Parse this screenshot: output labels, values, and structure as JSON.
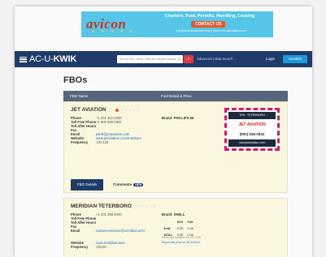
{
  "banner": {
    "logo": "avicon",
    "tagline": "Charters, Fuel, Permits, Handling, Leasing",
    "cta": "CONTACT US",
    "urls": "info@aviconaviation.com  |  www.aviconaviation.com",
    "stars": "★ ★ ★ ★ ★",
    "color_bg": "#55c6e8"
  },
  "nav": {
    "brand_prefix": "AC-U-",
    "brand_bold": "KWIK",
    "search_placeholder": "Find ICAO, IATA, FAA ID, Airport Name, or City",
    "links": "Advanced  |  Map Search",
    "login": "Login",
    "cta": "Vendors",
    "color_bg": "#1f3b6a"
  },
  "page": {
    "title": "FBOs",
    "columns": [
      "FBO Name",
      "Fuel Brand & Price"
    ]
  },
  "fbos": [
    {
      "name": "JET AVIATION",
      "rating": "☆☆☆☆☆",
      "fields": [
        {
          "label": "Phone",
          "value": "+1 201 462 4000"
        },
        {
          "label": "Toll Free Phone",
          "value": "+1 800 538 0832"
        },
        {
          "label": "Toll After Hours",
          "value": ""
        },
        {
          "label": "Fax",
          "value": ""
        },
        {
          "label": "Email",
          "value": "jeteb@jetaviation.com"
        },
        {
          "label": "Website",
          "value": "www.jetaviation.com/teterboro"
        },
        {
          "label": "Frequency",
          "value": "130.425"
        }
      ],
      "brand_label": "Brand: PHILLIPS 66",
      "ad": {
        "line1": "TEB - TETERBORO",
        "logo": "JET AVIATION",
        "phone": "(800) 538-0832",
        "url": "www.jetaviation.com"
      },
      "details_button": "FBO Details",
      "comments_label": "Comments",
      "comments_badge": "NEW"
    },
    {
      "name": "MERIDIAN TETERBORO",
      "rating": "☆☆☆☆☆",
      "fields": [
        {
          "label": "Phone",
          "value": "+1 201 288 5040"
        },
        {
          "label": "Toll Free Phone",
          "value": ""
        },
        {
          "label": "Toll After Hours",
          "value": ""
        },
        {
          "label": "Fax",
          "value": ""
        },
        {
          "label": "Email",
          "value": "customerservice@meridian.aero"
        },
        {
          "label": "Website",
          "value": "www.meridian.aero"
        },
        {
          "label": "Frequency",
          "value": "130.50"
        }
      ],
      "brand_label": "Brand: SHELL",
      "price_headers": [
        "",
        "Self",
        "Full"
      ],
      "price_rows": [
        [
          "JetA",
          "0.00",
          "0.00"
        ],
        [
          "100LL",
          "0.00",
          "0.00"
        ]
      ],
      "price_note1": "Prices last updated Jun 30, 2015",
      "price_note2": "Report fuel price for Jet-A/100LL"
    }
  ]
}
